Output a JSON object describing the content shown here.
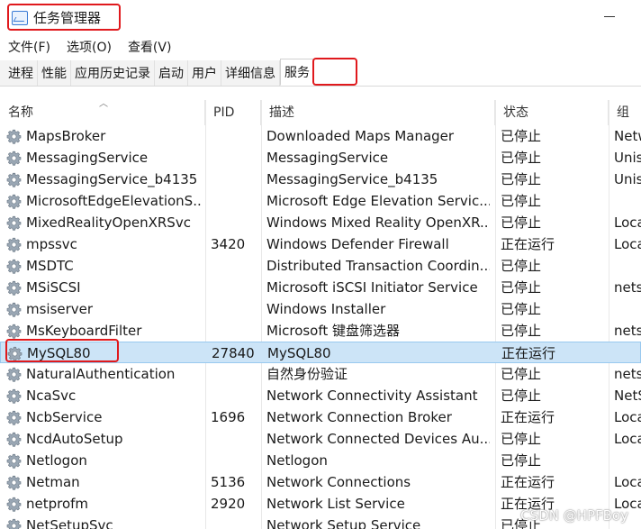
{
  "window": {
    "title": "任务管理器"
  },
  "menu": [
    "文件(F)",
    "选项(O)",
    "查看(V)"
  ],
  "tabs": [
    "进程",
    "性能",
    "应用历史记录",
    "启动",
    "用户",
    "详细信息",
    "服务"
  ],
  "active_tab": "服务",
  "columns": {
    "name": "名称",
    "pid": "PID",
    "desc": "描述",
    "status": "状态",
    "group": "组"
  },
  "rows": [
    {
      "name": "MapsBroker",
      "pid": "",
      "desc": "Downloaded Maps Manager",
      "status": "已停止",
      "group": "Netw"
    },
    {
      "name": "MessagingService",
      "pid": "",
      "desc": "MessagingService",
      "status": "已停止",
      "group": "Unis"
    },
    {
      "name": "MessagingService_b4135",
      "pid": "",
      "desc": "MessagingService_b4135",
      "status": "已停止",
      "group": "Unis"
    },
    {
      "name": "MicrosoftEdgeElevationS...",
      "pid": "",
      "desc": "Microsoft Edge Elevation Servic...",
      "status": "已停止",
      "group": ""
    },
    {
      "name": "MixedRealityOpenXRSvc",
      "pid": "",
      "desc": "Windows Mixed Reality OpenXR...",
      "status": "已停止",
      "group": "Loca"
    },
    {
      "name": "mpssvc",
      "pid": "3420",
      "desc": "Windows Defender Firewall",
      "status": "正在运行",
      "group": "Loca"
    },
    {
      "name": "MSDTC",
      "pid": "",
      "desc": "Distributed Transaction Coordin...",
      "status": "已停止",
      "group": ""
    },
    {
      "name": "MSiSCSI",
      "pid": "",
      "desc": "Microsoft iSCSI Initiator Service",
      "status": "已停止",
      "group": "nets"
    },
    {
      "name": "msiserver",
      "pid": "",
      "desc": "Windows Installer",
      "status": "已停止",
      "group": ""
    },
    {
      "name": "MsKeyboardFilter",
      "pid": "",
      "desc": "Microsoft 键盘筛选器",
      "status": "已停止",
      "group": "nets"
    },
    {
      "name": "MySQL80",
      "pid": "27840",
      "desc": "MySQL80",
      "status": "正在运行",
      "group": ""
    },
    {
      "name": "NaturalAuthentication",
      "pid": "",
      "desc": "自然身份验证",
      "status": "已停止",
      "group": "nets"
    },
    {
      "name": "NcaSvc",
      "pid": "",
      "desc": "Network Connectivity Assistant",
      "status": "已停止",
      "group": "NetS"
    },
    {
      "name": "NcbService",
      "pid": "1696",
      "desc": "Network Connection Broker",
      "status": "正在运行",
      "group": "Loca"
    },
    {
      "name": "NcdAutoSetup",
      "pid": "",
      "desc": "Network Connected Devices Au...",
      "status": "已停止",
      "group": "Loca"
    },
    {
      "name": "Netlogon",
      "pid": "",
      "desc": "Netlogon",
      "status": "已停止",
      "group": ""
    },
    {
      "name": "Netman",
      "pid": "5136",
      "desc": "Network Connections",
      "status": "正在运行",
      "group": "Loca"
    },
    {
      "name": "netprofm",
      "pid": "2920",
      "desc": "Network List Service",
      "status": "正在运行",
      "group": "Loca"
    },
    {
      "name": "NetSetupSvc",
      "pid": "",
      "desc": "Network Setup Service",
      "status": "已停止",
      "group": ""
    }
  ],
  "selected_row": "MySQL80",
  "watermark": "CSDN @HPFBoy",
  "colors": {
    "highlight_box": "#e0191d",
    "selection_bg": "#cce4f7"
  }
}
